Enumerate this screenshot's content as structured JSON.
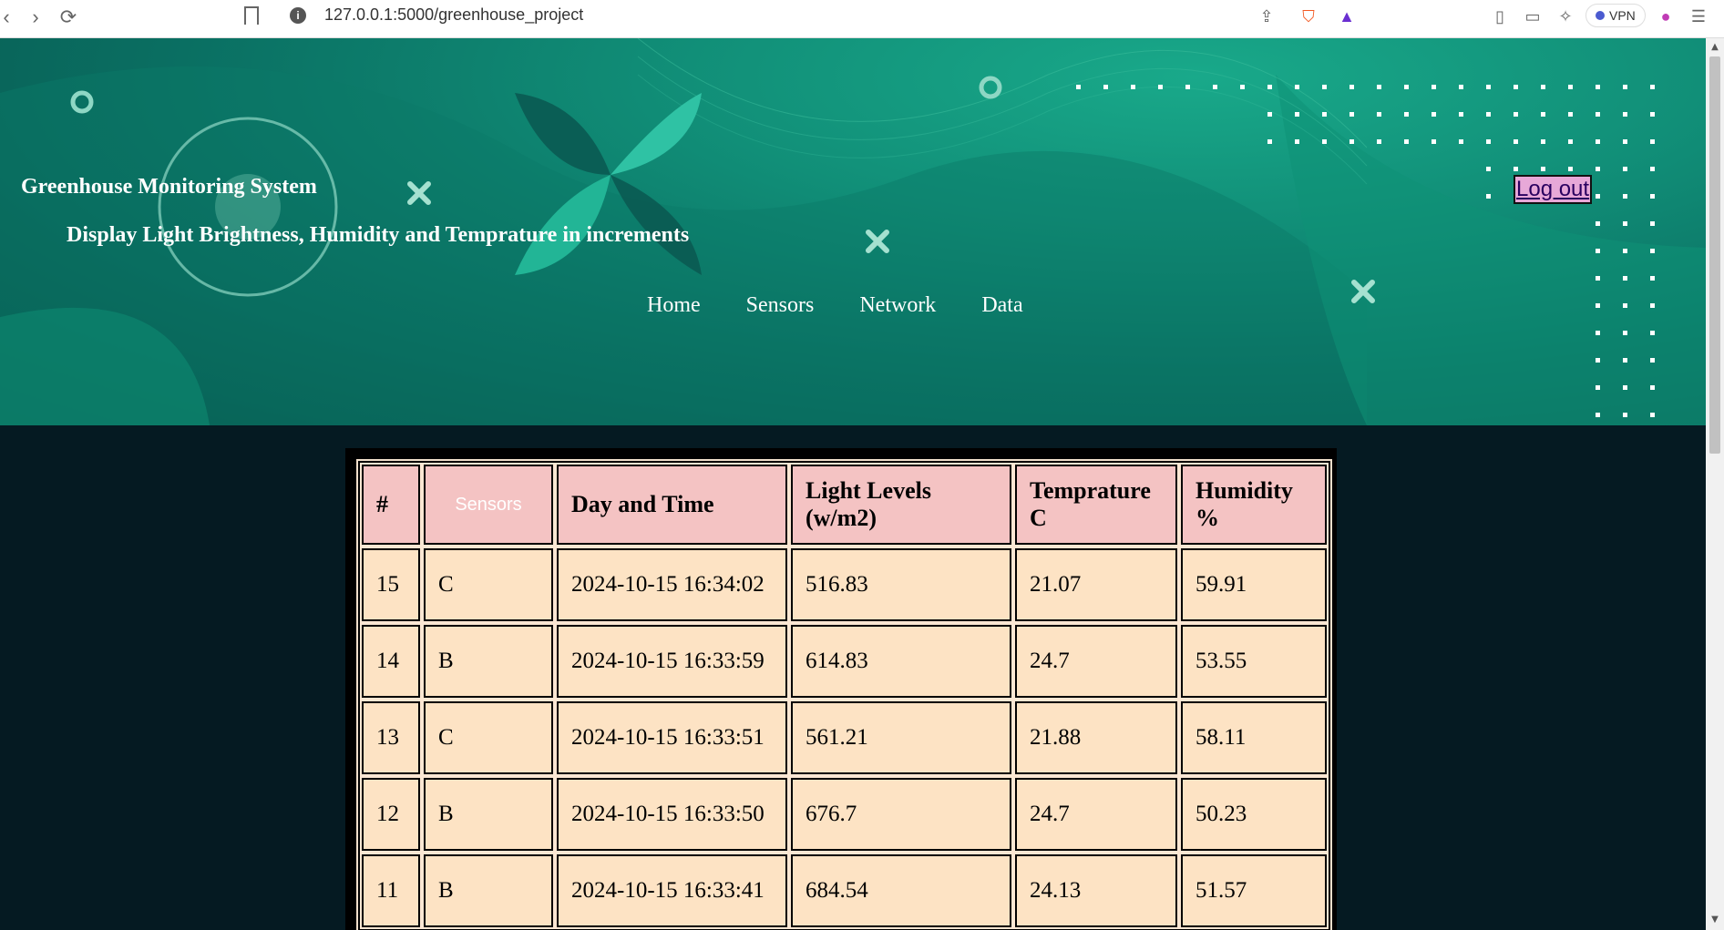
{
  "browser": {
    "url": "127.0.0.1:5000/greenhouse_project",
    "vpn_label": "VPN"
  },
  "header": {
    "title": "Greenhouse Monitoring System",
    "subtitle": "Display Light Brightness, Humidity and Temprature in increments",
    "logout_label": "Log out",
    "nav": [
      "Home",
      "Sensors",
      "Network",
      "Data"
    ]
  },
  "table": {
    "columns": [
      "#",
      "Sensors",
      "Day and Time",
      "Light Levels (w/m2)",
      "Temprature C",
      "Humidity %"
    ],
    "rows": [
      [
        "15",
        "C",
        "2024-10-15 16:34:02",
        "516.83",
        "21.07",
        "59.91"
      ],
      [
        "14",
        "B",
        "2024-10-15 16:33:59",
        "614.83",
        "24.7",
        "53.55"
      ],
      [
        "13",
        "C",
        "2024-10-15 16:33:51",
        "561.21",
        "21.88",
        "58.11"
      ],
      [
        "12",
        "B",
        "2024-10-15 16:33:50",
        "676.7",
        "24.7",
        "50.23"
      ],
      [
        "11",
        "B",
        "2024-10-15 16:33:41",
        "684.54",
        "24.13",
        "51.57"
      ]
    ]
  }
}
